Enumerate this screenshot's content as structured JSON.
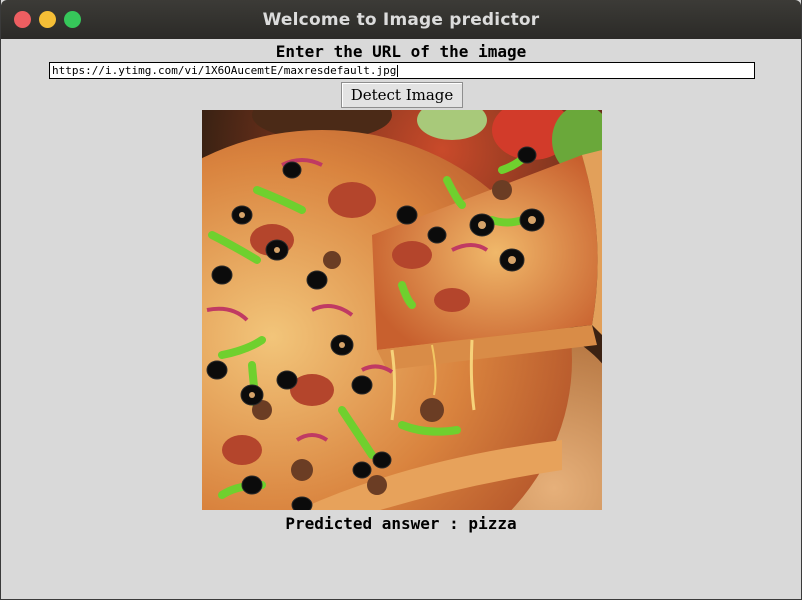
{
  "window": {
    "title": "Welcome to Image predictor"
  },
  "form": {
    "prompt": "Enter the URL of the image",
    "url_value": "https://i.ytimg.com/vi/1X6OAucemtE/maxresdefault.jpg",
    "detect_label": "Detect Image"
  },
  "image": {
    "icon": "pizza-photo"
  },
  "result": {
    "text": "Predicted answer : pizza"
  }
}
